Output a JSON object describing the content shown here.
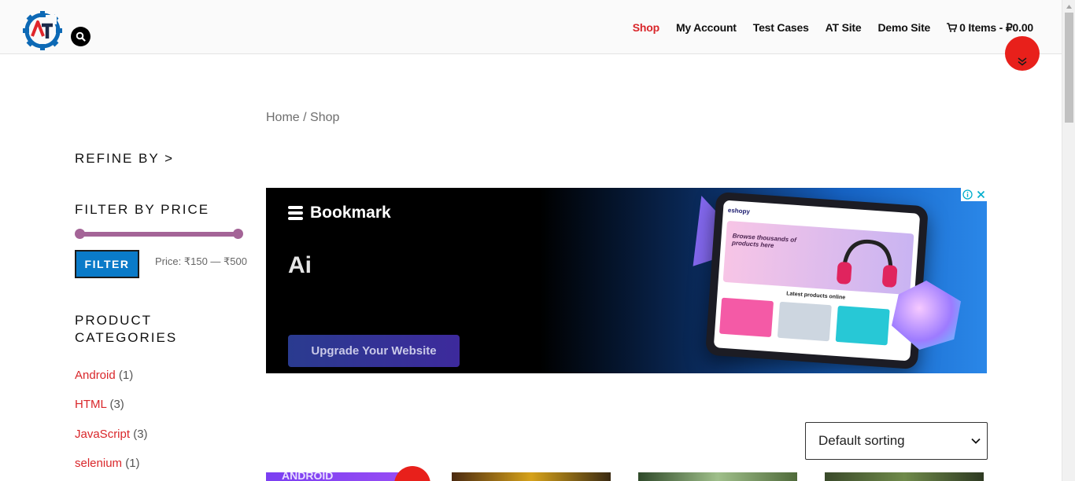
{
  "header": {
    "nav": [
      {
        "label": "Shop",
        "active": true
      },
      {
        "label": "My Account",
        "active": false
      },
      {
        "label": "Test Cases",
        "active": false
      },
      {
        "label": "AT Site",
        "active": false
      },
      {
        "label": "Demo Site",
        "active": false
      }
    ],
    "cart_label": "0 Items - ₽0.00",
    "icons": {
      "logo": "at-gear-logo",
      "search": "search-icon",
      "cart": "cart-icon",
      "scroll": "chevron-double-down-icon"
    }
  },
  "breadcrumb": "Home / Shop",
  "sidebar": {
    "refine_title": "REFINE BY >",
    "filter_title": "FILTER BY PRICE",
    "filter_button": "FILTER",
    "price_label": "Price: ₹150 — ₹500",
    "price_range": {
      "min": 150,
      "max": 500,
      "selected_min_fraction": 0,
      "selected_max_fraction": 1
    },
    "categories_title_line1": "PRODUCT",
    "categories_title_line2": "CATEGORIES",
    "categories": [
      {
        "name": "Android",
        "count": "(1)"
      },
      {
        "name": "HTML",
        "count": "(3)"
      },
      {
        "name": "JavaScript",
        "count": "(3)"
      },
      {
        "name": "selenium",
        "count": "(1)"
      }
    ]
  },
  "ad": {
    "brand": "Bookmark",
    "headline": "Ai",
    "cta": "Upgrade Your Website",
    "tablet_logo": "eshopy",
    "tablet_hero": "Browse thousands of products here",
    "tablet_latest": "Latest products online"
  },
  "sorting": {
    "selected": "Default sorting"
  },
  "products": {
    "first_thumb_text": "ANDROID"
  },
  "colors": {
    "accent": "#d9262a",
    "filter_button": "#0a7bc9",
    "slider": "#a46497",
    "scroll_top": "#e8201b"
  }
}
